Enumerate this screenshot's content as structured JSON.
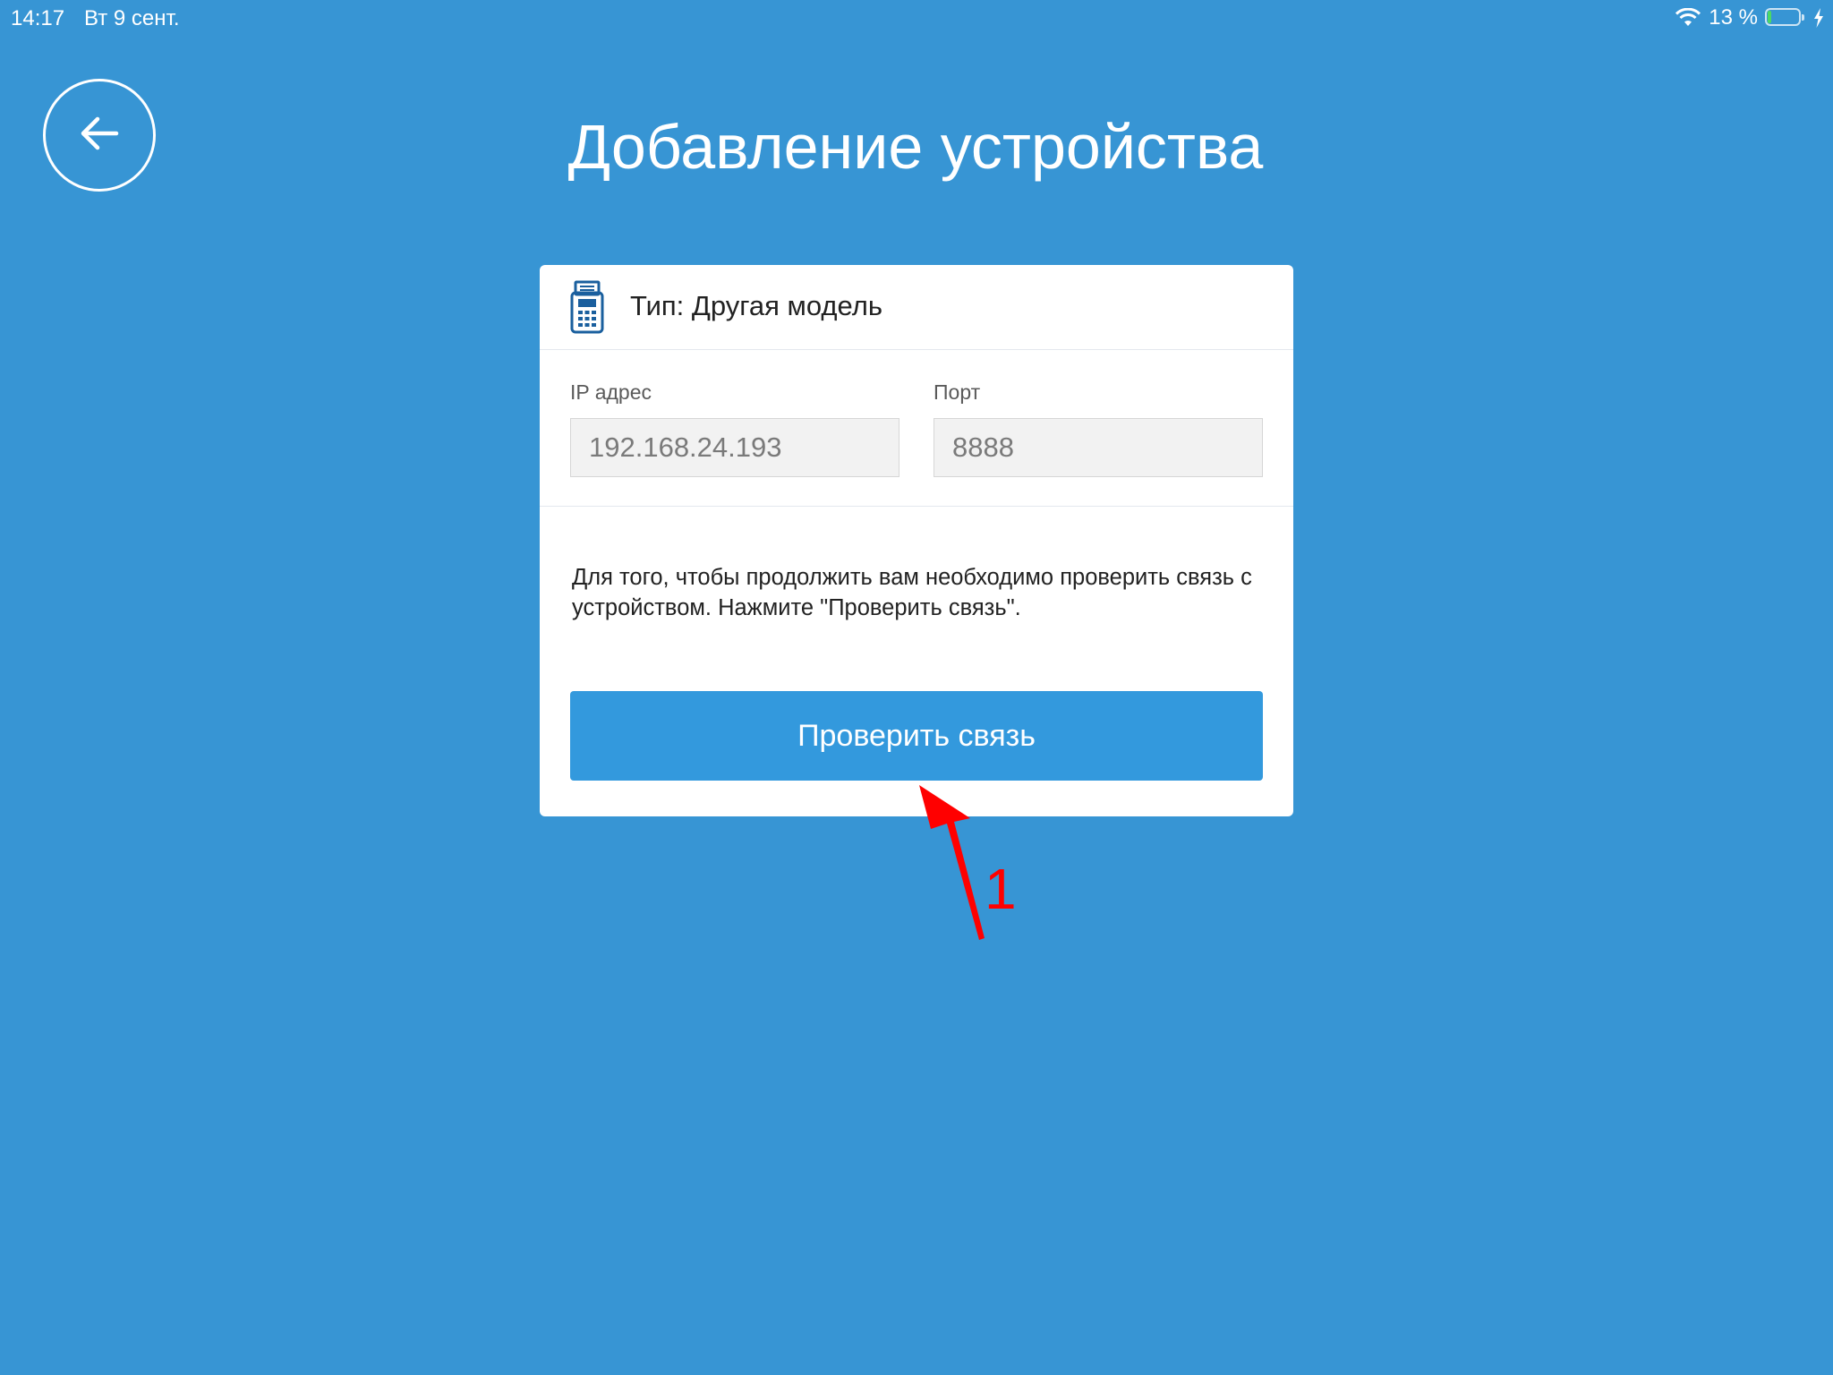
{
  "status_bar": {
    "time": "14:17",
    "date": "Вт 9 сент.",
    "battery_percent": "13 %",
    "battery_level": 0.13
  },
  "page": {
    "title": "Добавление устройства"
  },
  "card": {
    "type_label": "Тип: Другая модель",
    "ip_label": "IP адрес",
    "ip_value": "192.168.24.193",
    "port_label": "Порт",
    "port_value": "8888",
    "hint": "Для того, чтобы продолжить вам необходимо проверить связь с устройством. Нажмите \"Проверить связь\".",
    "check_button_label": "Проверить связь"
  },
  "annotation": {
    "number": "1"
  },
  "colors": {
    "background": "#3795d4",
    "button": "#3399dd",
    "device_icon": "#1a5f9e",
    "annotation": "#ff0000",
    "battery_fill": "#4cd964"
  },
  "icons": {
    "back": "arrow-left-icon",
    "device": "pos-terminal-icon",
    "wifi": "wifi-icon",
    "battery": "battery-icon",
    "charging": "charging-bolt-icon"
  }
}
